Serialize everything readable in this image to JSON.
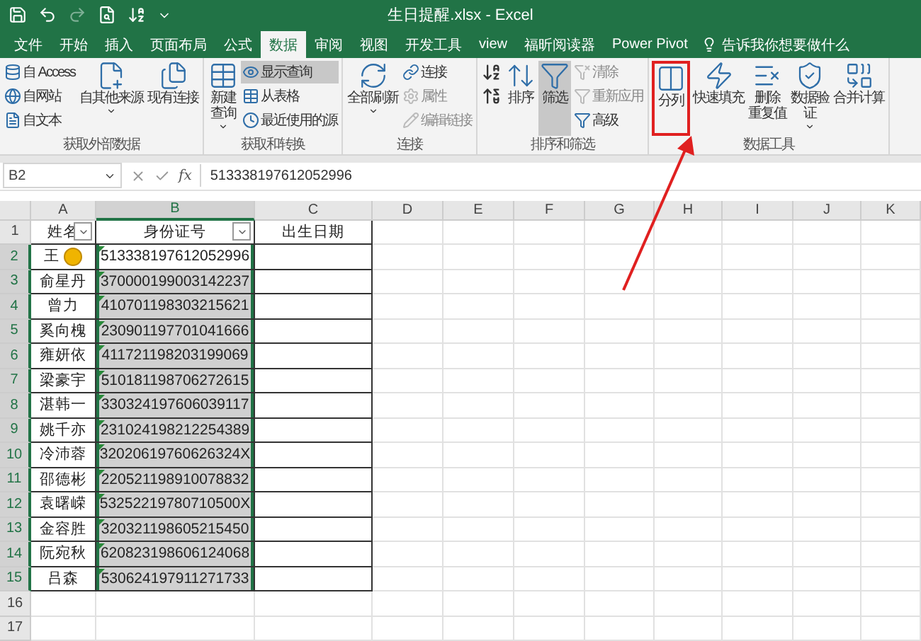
{
  "window": {
    "title": "生日提醒.xlsx  -  Excel"
  },
  "tabs": [
    {
      "label": "文件",
      "selected": false
    },
    {
      "label": "开始",
      "selected": false
    },
    {
      "label": "插入",
      "selected": false
    },
    {
      "label": "页面布局",
      "selected": false
    },
    {
      "label": "公式",
      "selected": false
    },
    {
      "label": "数据",
      "selected": true
    },
    {
      "label": "审阅",
      "selected": false
    },
    {
      "label": "视图",
      "selected": false
    },
    {
      "label": "开发工具",
      "selected": false
    },
    {
      "label": "view",
      "selected": false
    },
    {
      "label": "福昕阅读器",
      "selected": false
    },
    {
      "label": "Power Pivot",
      "selected": false
    }
  ],
  "tell_me": {
    "placeholder": "告诉我你想要做什么"
  },
  "ribbon": {
    "groups": [
      {
        "label": "获取外部数据",
        "items": [
          {
            "kind": "stack",
            "items": [
              {
                "label": "自 Access",
                "disabled": false,
                "selected": false
              },
              {
                "label": "自网站",
                "disabled": false,
                "selected": false
              },
              {
                "label": "自文本",
                "disabled": false,
                "selected": false
              }
            ]
          },
          {
            "kind": "large",
            "label": "自其他来源",
            "dropdown": true,
            "pressed": false
          },
          {
            "kind": "large",
            "label": "现有连接",
            "dropdown": false,
            "pressed": false
          }
        ]
      },
      {
        "label": "获取和转换",
        "items": [
          {
            "kind": "large",
            "lines": [
              "新建",
              "查询"
            ],
            "dropdown": true,
            "pressed": false
          },
          {
            "kind": "stack",
            "items": [
              {
                "label": "显示查询",
                "disabled": false,
                "selected": true
              },
              {
                "label": "从表格",
                "disabled": false,
                "selected": false
              },
              {
                "label": "最近使用的源",
                "disabled": false,
                "selected": false
              }
            ]
          }
        ]
      },
      {
        "label": "连接",
        "items": [
          {
            "kind": "large",
            "label": "全部刷新",
            "dropdown": true,
            "pressed": false
          },
          {
            "kind": "stack",
            "items": [
              {
                "label": "连接",
                "disabled": false,
                "selected": false
              },
              {
                "label": "属性",
                "disabled": true,
                "selected": false
              },
              {
                "label": "编辑链接",
                "disabled": true,
                "selected": false
              }
            ]
          }
        ]
      },
      {
        "label": "排序和筛选",
        "items": [
          {
            "kind": "sortstack"
          },
          {
            "kind": "large",
            "label": "排序",
            "dropdown": false,
            "pressed": false
          },
          {
            "kind": "large",
            "label": "筛选",
            "dropdown": false,
            "pressed": true
          },
          {
            "kind": "stack",
            "items": [
              {
                "label": "清除",
                "disabled": true,
                "selected": false
              },
              {
                "label": "重新应用",
                "disabled": true,
                "selected": false
              },
              {
                "label": "高级",
                "disabled": false,
                "selected": false
              }
            ]
          }
        ]
      },
      {
        "label": "数据工具",
        "items": [
          {
            "kind": "large",
            "label": "分列",
            "dropdown": false,
            "pressed": false
          },
          {
            "kind": "large",
            "label": "快速填充",
            "dropdown": false,
            "pressed": false
          },
          {
            "kind": "large",
            "lines": [
              "删除",
              "重复值"
            ],
            "dropdown": false,
            "pressed": false
          },
          {
            "kind": "large",
            "lines": [
              "数据验",
              "证"
            ],
            "dropdown": true,
            "pressed": false
          },
          {
            "kind": "large",
            "label": "合并计算",
            "dropdown": false,
            "pressed": false
          }
        ]
      }
    ]
  },
  "formula_bar": {
    "name_box": "B2",
    "function_label": "fx",
    "value": "513338197612052996"
  },
  "columns": [
    {
      "label": "A",
      "selected": false
    },
    {
      "label": "B",
      "selected": true
    },
    {
      "label": "C",
      "selected": false
    },
    {
      "label": "D",
      "selected": false
    },
    {
      "label": "E",
      "selected": false
    },
    {
      "label": "F",
      "selected": false
    },
    {
      "label": "G",
      "selected": false
    },
    {
      "label": "H",
      "selected": false
    },
    {
      "label": "I",
      "selected": false
    },
    {
      "label": "J",
      "selected": false
    },
    {
      "label": "K",
      "selected": false
    }
  ],
  "rows": [
    {
      "number": "1",
      "selected": false,
      "in_table": true,
      "cells": [
        {
          "text": "姓名",
          "filter": true
        },
        {
          "text": "身份证号",
          "filter": true
        },
        {
          "text": "出生日期"
        }
      ]
    },
    {
      "number": "2",
      "selected": true,
      "in_table": true,
      "cells": [
        {
          "text": "王",
          "warning": true
        },
        {
          "text": "513338197612052996",
          "selected": true,
          "active": true,
          "flag": true
        }
      ]
    },
    {
      "number": "3",
      "selected": true,
      "in_table": true,
      "cells": [
        {
          "text": "俞星丹"
        },
        {
          "text": "370000199003142237",
          "selected": true,
          "active": false,
          "flag": true
        }
      ]
    },
    {
      "number": "4",
      "selected": true,
      "in_table": true,
      "cells": [
        {
          "text": "曾力"
        },
        {
          "text": "410701198303215621",
          "selected": true,
          "active": false,
          "flag": true
        }
      ]
    },
    {
      "number": "5",
      "selected": true,
      "in_table": true,
      "cells": [
        {
          "text": "奚向槐"
        },
        {
          "text": "230901197701041666",
          "selected": true,
          "active": false,
          "flag": true
        }
      ]
    },
    {
      "number": "6",
      "selected": true,
      "in_table": true,
      "cells": [
        {
          "text": "雍妍依"
        },
        {
          "text": "411721198203199069",
          "selected": true,
          "active": false,
          "flag": true
        }
      ]
    },
    {
      "number": "7",
      "selected": true,
      "in_table": true,
      "cells": [
        {
          "text": "梁豪宇"
        },
        {
          "text": "510181198706272615",
          "selected": true,
          "active": false,
          "flag": true
        }
      ]
    },
    {
      "number": "8",
      "selected": true,
      "in_table": true,
      "cells": [
        {
          "text": "湛韩一"
        },
        {
          "text": "330324197606039117",
          "selected": true,
          "active": false,
          "flag": true
        }
      ]
    },
    {
      "number": "9",
      "selected": true,
      "in_table": true,
      "cells": [
        {
          "text": "姚千亦"
        },
        {
          "text": "231024198212254389",
          "selected": true,
          "active": false,
          "flag": true
        }
      ]
    },
    {
      "number": "10",
      "selected": true,
      "in_table": true,
      "cells": [
        {
          "text": "冷沛蓉"
        },
        {
          "text": "32020619760626324X",
          "selected": true,
          "active": false,
          "flag": true
        }
      ]
    },
    {
      "number": "11",
      "selected": true,
      "in_table": true,
      "cells": [
        {
          "text": "邵德彬"
        },
        {
          "text": "220521198910078832",
          "selected": true,
          "active": false,
          "flag": true
        }
      ]
    },
    {
      "number": "12",
      "selected": true,
      "in_table": true,
      "cells": [
        {
          "text": "袁曙嵘"
        },
        {
          "text": "53252219780710500X",
          "selected": true,
          "active": false,
          "flag": true
        }
      ]
    },
    {
      "number": "13",
      "selected": true,
      "in_table": true,
      "cells": [
        {
          "text": "金容胜"
        },
        {
          "text": "320321198605215450",
          "selected": true,
          "active": false,
          "flag": true
        }
      ]
    },
    {
      "number": "14",
      "selected": true,
      "in_table": true,
      "cells": [
        {
          "text": "阮宛秋"
        },
        {
          "text": "620823198606124068",
          "selected": true,
          "active": false,
          "flag": true
        }
      ]
    },
    {
      "number": "15",
      "selected": true,
      "in_table": true,
      "cells": [
        {
          "text": "吕森"
        },
        {
          "text": "530624197911271733",
          "selected": true,
          "active": false,
          "flag": true
        }
      ]
    },
    {
      "number": "16",
      "selected": false,
      "in_table": false,
      "cells": []
    },
    {
      "number": "17",
      "selected": false,
      "in_table": false,
      "cells": []
    }
  ]
}
